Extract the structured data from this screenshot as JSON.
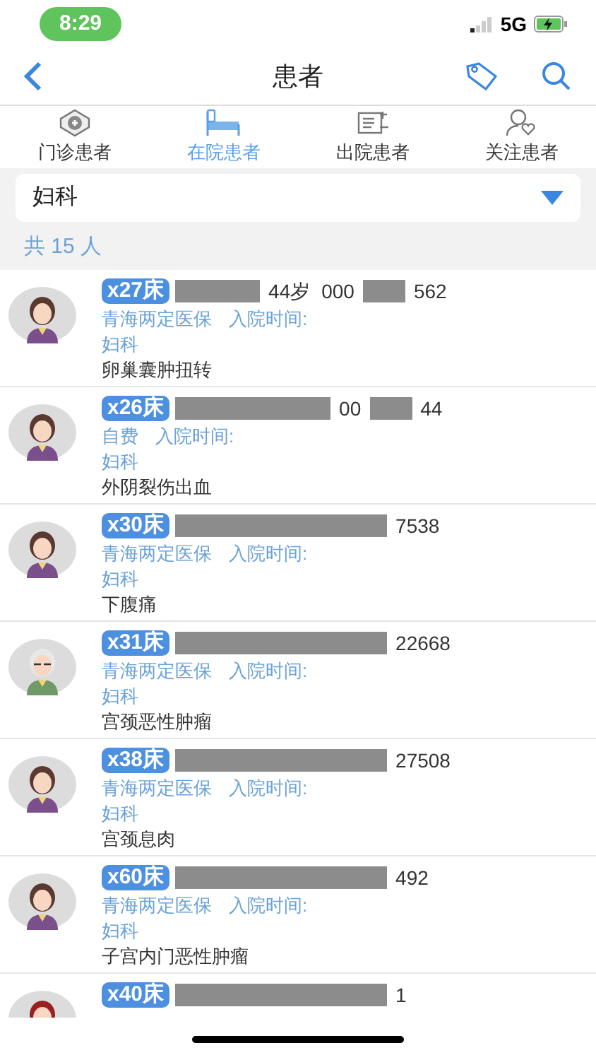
{
  "status_bar": {
    "time": "8:29",
    "network": "5G"
  },
  "nav": {
    "title": "患者"
  },
  "tabs": [
    {
      "label": "门诊患者",
      "kind": "clinic",
      "selected": false
    },
    {
      "label": "在院患者",
      "kind": "bed",
      "selected": true
    },
    {
      "label": "出院患者",
      "kind": "discharge",
      "selected": false
    },
    {
      "label": "关注患者",
      "kind": "follow",
      "selected": false
    }
  ],
  "department_select": {
    "value": "妇科"
  },
  "count": "共 15 人",
  "patients": [
    {
      "bed": "x27床",
      "avatar": {
        "kind": "woman"
      },
      "segments": [
        {
          "kind": "medium"
        },
        {
          "kind": "text",
          "text": "44岁"
        },
        {
          "kind": "text",
          "text": "000"
        },
        {
          "kind": "short"
        },
        {
          "kind": "text",
          "text": "562"
        }
      ],
      "insurance": "青海两定医保",
      "admit": "入院时间:",
      "department": "妇科",
      "diagnosis": "卵巢囊肿扭转"
    },
    {
      "bed": "x26床",
      "avatar": {
        "kind": "woman"
      },
      "segments": [
        {
          "kind": "long"
        },
        {
          "kind": "text",
          "text": "00"
        },
        {
          "kind": "short"
        },
        {
          "kind": "text",
          "text": "44"
        }
      ],
      "insurance": "自费",
      "admit": "入院时间:",
      "department": "妇科",
      "diagnosis": "外阴裂伤出血"
    },
    {
      "bed": "x30床",
      "avatar": {
        "kind": "woman"
      },
      "segments": [
        {
          "kind": "wide"
        },
        {
          "kind": "text",
          "text": "7538"
        }
      ],
      "insurance": "青海两定医保",
      "admit": "入院时间:",
      "department": "妇科",
      "diagnosis": "下腹痛"
    },
    {
      "bed": "x31床",
      "avatar": {
        "kind": "elder"
      },
      "segments": [
        {
          "kind": "wide"
        },
        {
          "kind": "text",
          "text": "22668"
        }
      ],
      "insurance": "青海两定医保",
      "admit": "入院时间:",
      "department": "妇科",
      "diagnosis": "宫颈恶性肿瘤"
    },
    {
      "bed": "x38床",
      "avatar": {
        "kind": "woman"
      },
      "segments": [
        {
          "kind": "wide"
        },
        {
          "kind": "text",
          "text": "27508"
        }
      ],
      "insurance": "青海两定医保",
      "admit": "入院时间:",
      "department": "妇科",
      "diagnosis": "宫颈息肉"
    },
    {
      "bed": "x60床",
      "avatar": {
        "kind": "woman"
      },
      "segments": [
        {
          "kind": "wide"
        },
        {
          "kind": "text",
          "text": "492"
        }
      ],
      "insurance": "青海两定医保",
      "admit": "入院时间:",
      "department": "妇科",
      "diagnosis": "子宫内门恶性肿瘤"
    },
    {
      "bed": "x40床",
      "avatar": {
        "kind": "red"
      },
      "segments": [
        {
          "kind": "wide"
        },
        {
          "kind": "text",
          "text": "1"
        }
      ]
    }
  ]
}
